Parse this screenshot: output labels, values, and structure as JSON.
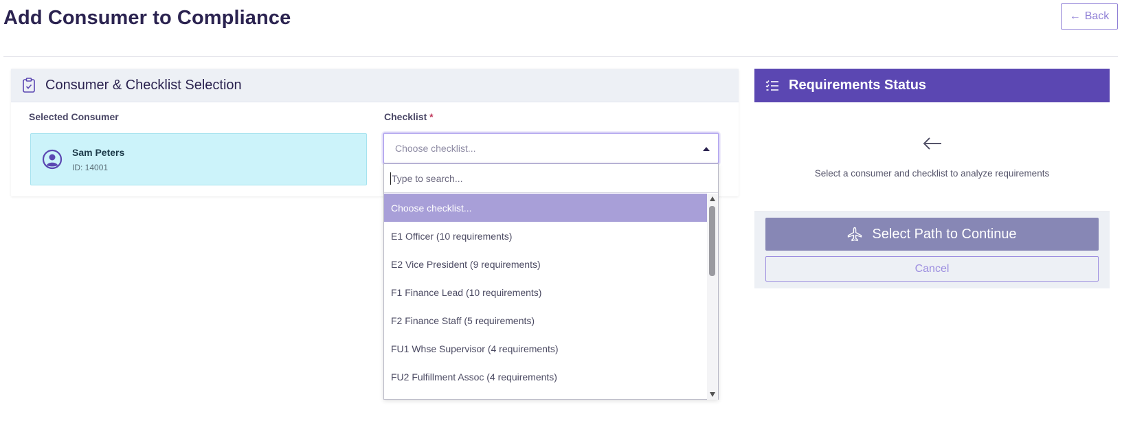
{
  "page": {
    "title": "Add Consumer to Compliance",
    "back_label": "Back"
  },
  "selection_card": {
    "title": "Consumer & Checklist Selection",
    "consumer_label": "Selected Consumer",
    "consumer_name": "Sam Peters",
    "consumer_id": "ID: 14001",
    "checklist_label": "Checklist",
    "required_marker": "*",
    "checklist_placeholder": "Choose checklist..."
  },
  "dropdown": {
    "search_placeholder": "Type to search...",
    "options": [
      "Choose checklist...",
      "E1 Officer (10 requirements)",
      "E2 Vice President (9 requirements)",
      "F1 Finance Lead (10 requirements)",
      "F2 Finance Staff (5 requirements)",
      "FU1 Whse Supervisor (4 requirements)",
      "FU2 Fulfillment Assoc (4 requirements)"
    ],
    "highlighted_index": 0
  },
  "status_card": {
    "title": "Requirements Status",
    "empty_message": "Select a consumer and checklist to analyze requirements",
    "primary_button": "Select Path to Continue",
    "cancel_button": "Cancel"
  },
  "colors": {
    "accent": "#5b47b2",
    "highlight": "#a89fd8",
    "consumer_bg": "#ccf3fa",
    "disabled_button": "#8787b5"
  },
  "icons": {
    "back": "left-arrow-icon",
    "clipboard": "clipboard-check-icon",
    "avatar": "user-circle-icon",
    "list": "list-check-icon",
    "status_placeholder": "left-arrow-icon",
    "plane": "plane-icon"
  }
}
